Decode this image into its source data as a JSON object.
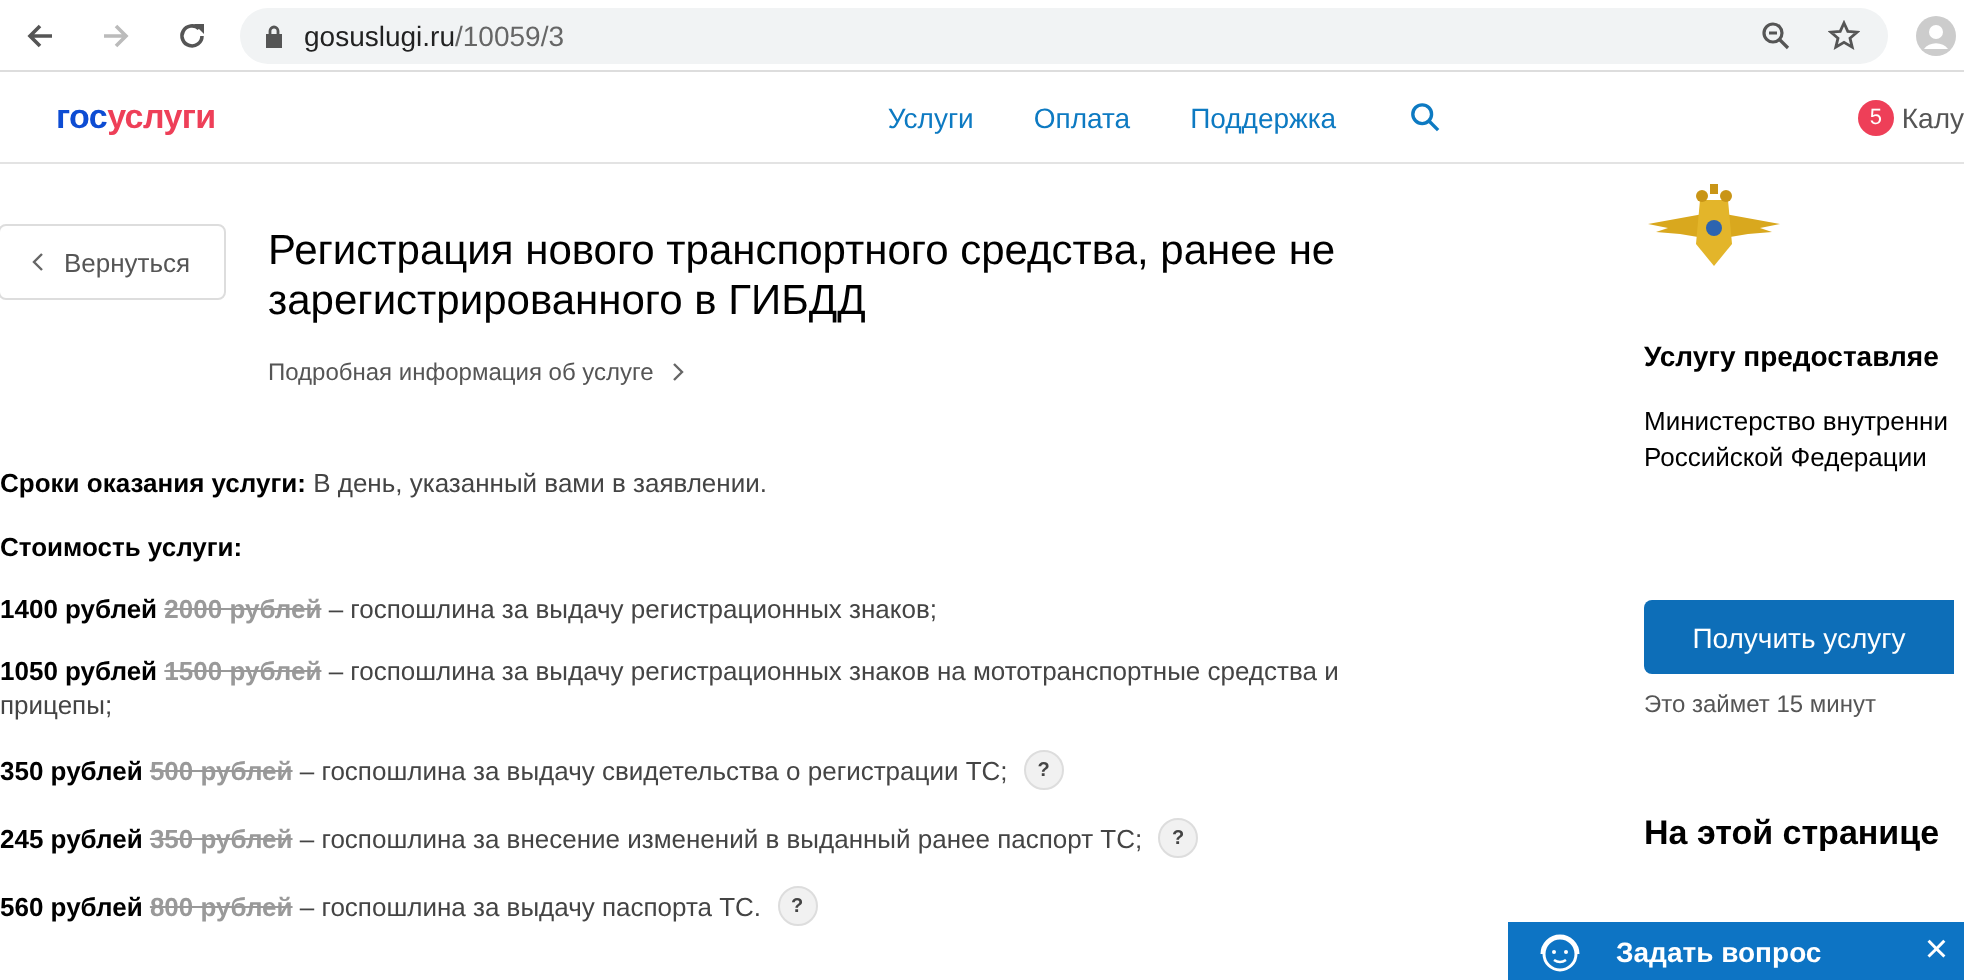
{
  "browser": {
    "back_disabled": false,
    "forward_disabled": true,
    "url_host": "gosuslugi.ru",
    "url_path": "/10059/3"
  },
  "header": {
    "logo_part1": "гос",
    "logo_part2": "услуги",
    "nav": [
      {
        "label": "Услуги"
      },
      {
        "label": "Оплата"
      },
      {
        "label": "Поддержка"
      }
    ],
    "notification_count": "5",
    "user_name": "Калу"
  },
  "back_button": "Вернуться",
  "title": "Регистрация нового транспортного средства, ранее не зарегистрированного в ГИБДД",
  "details_link": "Подробная информация об услуге",
  "deadline": {
    "label": "Сроки оказания услуги:",
    "value": "В день, указанный вами в заявлении."
  },
  "cost_label": "Стоимость услуги:",
  "prices": [
    {
      "price": "1400 рублей",
      "old_price": "2000 рублей",
      "description": "– госпошлина за выдачу регистрационных знаков;",
      "help": false
    },
    {
      "price": "1050 рублей",
      "old_price": "1500 рублей",
      "description": "– госпошлина за выдачу регистрационных знаков на мототранспортные средства и прицепы;",
      "help": false
    },
    {
      "price": "350 рублей",
      "old_price": "500 рублей",
      "description": "– госпошлина за выдачу свидетельства о регистрации ТС;",
      "help": true
    },
    {
      "price": "245 рублей",
      "old_price": "350 рублей",
      "description": "– госпошлина за внесение изменений в выданный ранее паспорт ТС;",
      "help": true
    },
    {
      "price": "560 рублей",
      "old_price": "800 рублей",
      "description": "– госпошлина за выдачу паспорта ТС.",
      "help": true
    }
  ],
  "help_mark": "?",
  "sidebar": {
    "provider_heading": "Услугу предоставляе",
    "provider_name": "Министерство внутренни",
    "provider_name_line2": "Российской Федерации",
    "action_button": "Получить услугу",
    "duration": "Это займет 15 минут",
    "toc_heading": "На этой странице"
  },
  "chat": {
    "label": "Задать вопрос",
    "close": "×"
  }
}
